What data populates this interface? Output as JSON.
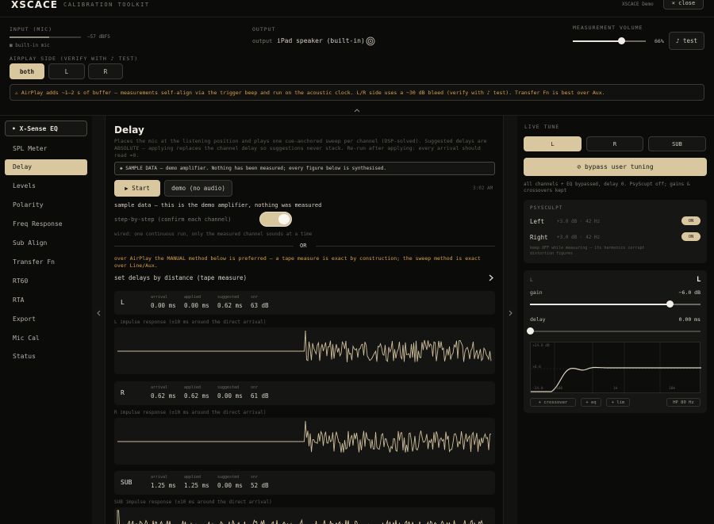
{
  "header": {
    "logo": "XSCACE",
    "title": "CALIBRATION TOOLKIT",
    "demo_label": "XSCACE Demo",
    "close_label": "× close"
  },
  "input": {
    "label": "INPUT (MIC)",
    "level": 0.55,
    "dbfs": "−57 dBFS",
    "source": "built-in mic"
  },
  "output": {
    "label": "OUTPUT",
    "prefix": "output",
    "device": "iPad speaker (built-in)"
  },
  "volume": {
    "label": "MEASUREMENT VOLUME",
    "value": 0.66,
    "value_text": "66%",
    "test_label": "♪ test"
  },
  "airplay": {
    "label": "AIRPLAY SIDE (VERIFY WITH ♪ TEST)",
    "options": [
      "both",
      "L",
      "R"
    ],
    "selected": "both",
    "notice": "⚠ AirPlay adds ~1–2 s of buffer — measurements self-align via the trigger beep and run on the acoustic clock. L/R side uses a −30 dB bleed (verify with ♪ test). Transfer Fn is best over Aux."
  },
  "collapse_icon": "chevron-up-icon",
  "sidebar": {
    "header": "• X-Sense EQ",
    "items": [
      "SPL Meter",
      "Delay",
      "Levels",
      "Polarity",
      "Freq Response",
      "Sub Align",
      "Transfer Fn",
      "RT60",
      "RTA",
      "Export",
      "Mic Cal",
      "Status"
    ],
    "active": "Delay"
  },
  "main": {
    "title": "Delay",
    "description": "Places the mic at the listening position and plays one cue-anchored sweep per channel (DSP-solved). Suggested delays are ABSOLUTE — applying replaces the channel delay so suggestions never stack. Re-run after applying: every arrival should read ≈0.",
    "sample_notice": "◈ SAMPLE DATA — demo amplifier. Nothing has been measured; every figure below is synthesised.",
    "start_label": "▶ Start",
    "demo_label": "demo (no audio)",
    "time": "3:02 AM",
    "sample_line": "sample data — this is the demo amplifier, nothing was measured",
    "step_label": "step-by-step (confirm each channel)",
    "step_enabled": true,
    "wired_note": "wired: one continuous run, only the measured channel sounds at a time",
    "or_label": "OR",
    "airplay_note": "over AirPlay the MANUAL method below is preferred — a tape measure is exact by construction; the sweep method is exact over Line/Aux.",
    "tape_label": "set delays by distance (tape measure)",
    "columns": [
      "arrival",
      "applied",
      "suggested",
      "snr"
    ],
    "channels": [
      {
        "name": "L",
        "arrival": "0.00 ms",
        "applied": "0.00 ms",
        "suggested": "0.62 ms",
        "snr": "63 dB",
        "caption": "L impulse response (±10 ms around the direct arrival)"
      },
      {
        "name": "R",
        "arrival": "0.62 ms",
        "applied": "0.62 ms",
        "suggested": "0.00 ms",
        "snr": "61 dB",
        "caption": "R impulse response (±10 ms around the direct arrival)"
      },
      {
        "name": "SUB",
        "arrival": "1.25 ms",
        "applied": "1.25 ms",
        "suggested": "0.00 ms",
        "snr": "52 dB",
        "caption": "SUB impulse response (±10 ms around the direct arrival)"
      }
    ]
  },
  "live": {
    "label": "LIVE TUNE",
    "tabs": [
      "L",
      "R",
      "SUB"
    ],
    "selected": "L",
    "bypass_label": "⊘ bypass user tuning",
    "bypass_note": "all channels + EQ bypassed, delay 0. PsyScupt off; gains & crossovers kept",
    "psy": {
      "label": "PSYSCULPT",
      "left_label": "Left",
      "left_detail": "+3.0 dB · 42 Hz",
      "right_label": "Right",
      "right_detail": "+3.0 dB · 42 Hz",
      "on_text": "ON",
      "note": "keep OFF while measuring — its harmonics corrupt distortion figures"
    },
    "channel": {
      "label": "L",
      "big": "L",
      "gain_label": "gain",
      "gain_value": "−6.0 dB",
      "gain_level": 0.82,
      "delay_label": "delay",
      "delay_value": "0.00 ms",
      "delay_level": 0.0
    },
    "graph": {
      "y_top": "+24.0 dB",
      "y_mid": "+0.0",
      "y_low": "-24.0",
      "x_ticks": [
        "100",
        "1k",
        "10k"
      ]
    },
    "chips": [
      "+ crossover",
      "+ eq",
      "+ lim"
    ],
    "hp_label": "HP 80 Hz"
  }
}
